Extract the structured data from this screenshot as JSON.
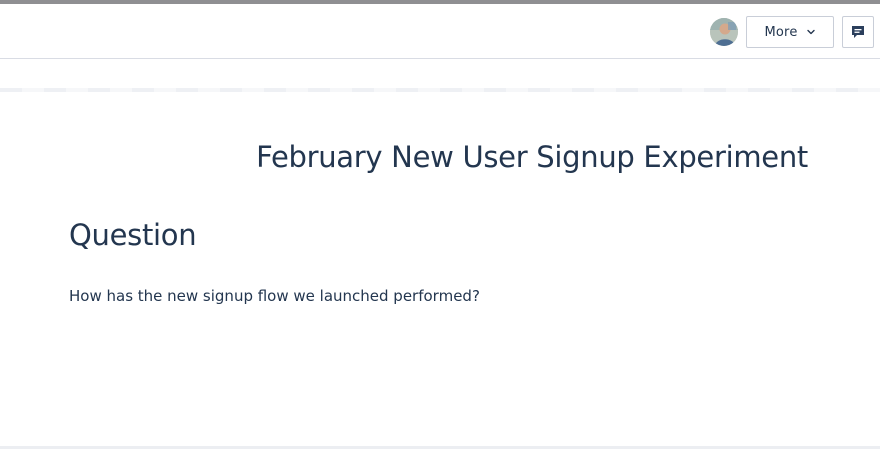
{
  "toolbar": {
    "more_label": "More",
    "icons": {
      "avatar": "user-avatar",
      "more_chevron": "chevron-down-icon",
      "comment": "comment-icon"
    },
    "colors": {
      "text": "#23364f",
      "border": "#c9ced8",
      "icon": "#2b3f5c"
    }
  },
  "document": {
    "title": "February New User Signup Experiment",
    "section_heading": "Question",
    "question_text": "How has the new signup flow we launched performed?"
  }
}
